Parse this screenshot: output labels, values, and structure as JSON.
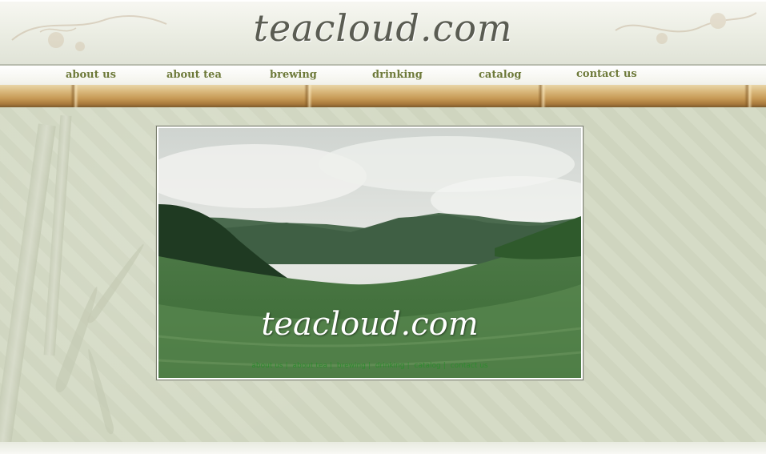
{
  "header": {
    "logo_text": "teacloud.com"
  },
  "nav": {
    "items": [
      {
        "label": "about us"
      },
      {
        "label": "about tea"
      },
      {
        "label": "brewing"
      },
      {
        "label": "drinking"
      },
      {
        "label": "catalog"
      },
      {
        "label": "contact us"
      }
    ]
  },
  "hero": {
    "logo_text": "teacloud.com",
    "links": [
      "about us",
      "about tea",
      "brewing",
      "drinking",
      "catalog",
      "contact us"
    ]
  },
  "colors": {
    "nav_text": "#6e7a3a",
    "background": "#d3d9c3",
    "bamboo": "#c79a56",
    "hero_links": "#2f8a2f"
  }
}
